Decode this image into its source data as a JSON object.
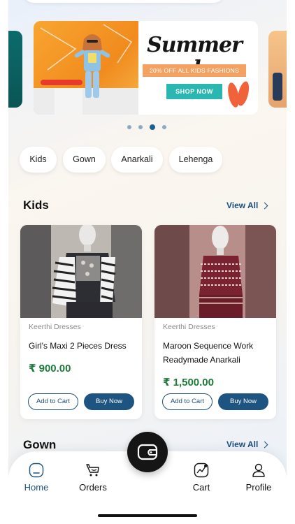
{
  "banner": {
    "title": "Summer sale.",
    "subtitle": "20% OFF ALL KIDS FASHIONS",
    "cta": "SHOP NOW"
  },
  "carousel": {
    "slide_count": 4,
    "active_index": 2
  },
  "categories": [
    "Kids",
    "Gown",
    "Anarkali",
    "Lehenga"
  ],
  "sections": {
    "kids": {
      "title": "Kids",
      "view_all": "View All"
    },
    "gown": {
      "title": "Gown",
      "view_all": "View All"
    }
  },
  "products": [
    {
      "seller": "Keerthi Dresses",
      "name": "Girl's Maxi 2 Pieces Dress",
      "price": "₹ 900.00",
      "add_to_cart": "Add to Cart",
      "buy_now": "Buy Now"
    },
    {
      "seller": "Keerthi Dresses",
      "name": "Maroon Sequence Work Readymade Anarkali",
      "price": "₹ 1,500.00",
      "add_to_cart": "Add to Cart",
      "buy_now": "Buy Now"
    }
  ],
  "nav": {
    "home": "Home",
    "orders": "Orders",
    "cart": "Cart",
    "profile": "Profile",
    "active": "home"
  },
  "colors": {
    "primary": "#1d5482",
    "price": "#1e7a3a",
    "banner_orange": "#f18b1e",
    "banner_teal": "#2ab7b1"
  }
}
